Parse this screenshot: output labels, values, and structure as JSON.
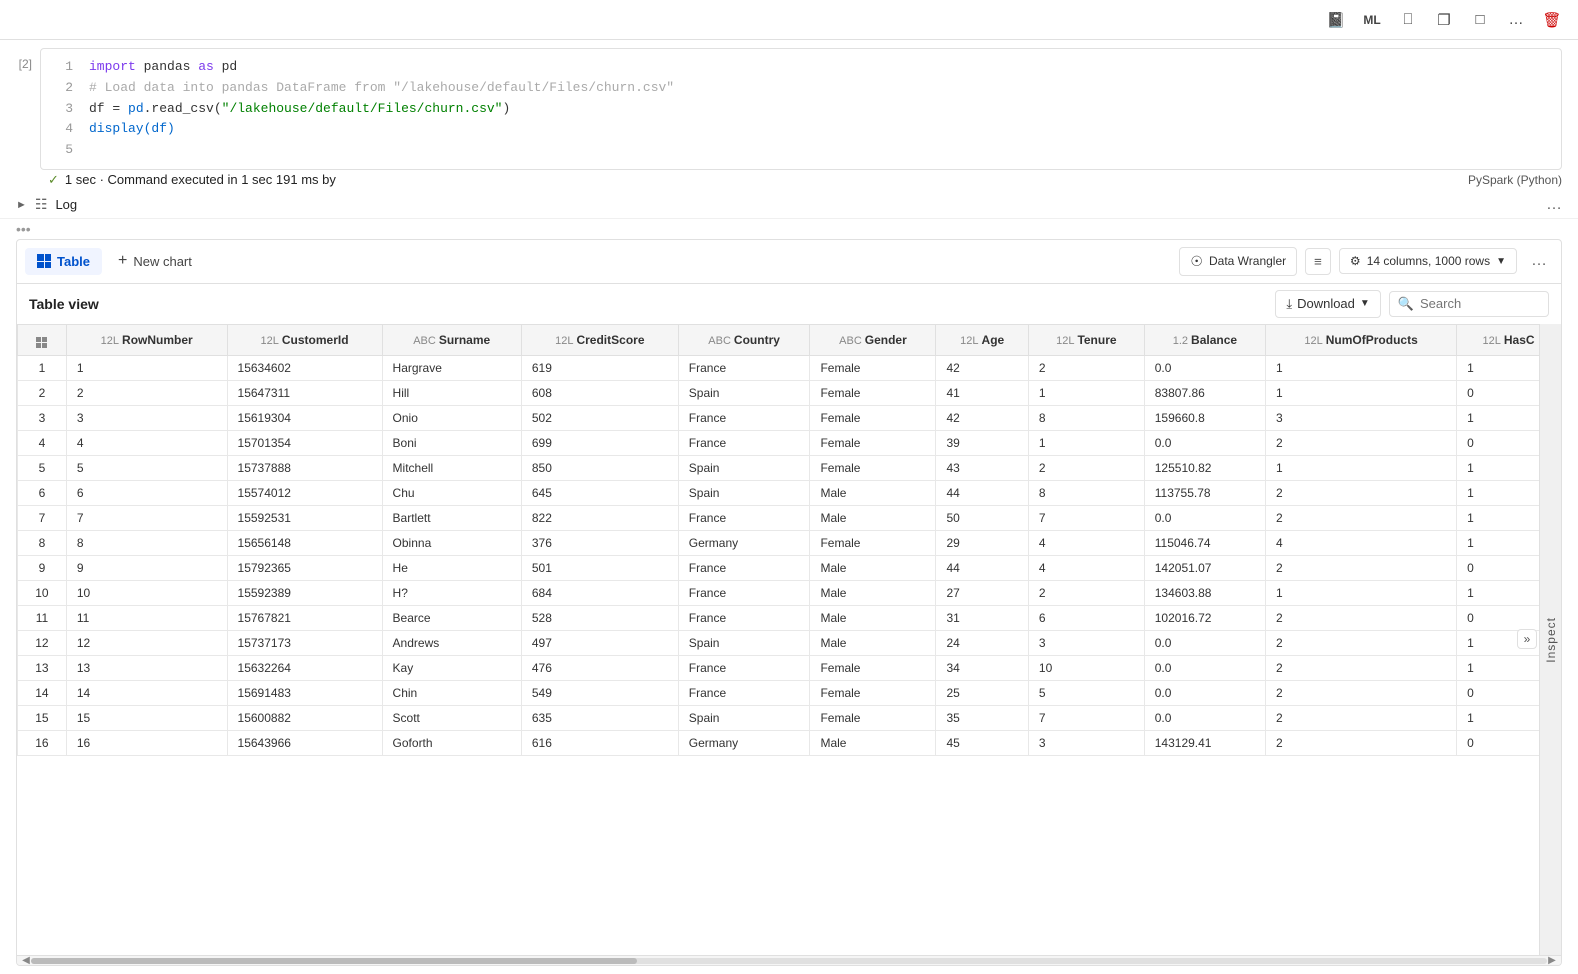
{
  "toolbar": {
    "icons": [
      "notebook-icon",
      "ml-icon",
      "monitor-icon",
      "copy-icon",
      "comment-icon",
      "more-icon",
      "delete-icon"
    ]
  },
  "cell": {
    "number": "[2]",
    "status": "1 sec · Command executed in 1 sec 191 ms by",
    "runtime": "PySpark (Python)",
    "lines": [
      {
        "num": "1",
        "tokens": [
          {
            "text": "import ",
            "cls": "kw"
          },
          {
            "text": "pandas",
            "cls": "plain"
          },
          {
            "text": " as ",
            "cls": "kw"
          },
          {
            "text": "pd",
            "cls": "plain"
          }
        ]
      },
      {
        "num": "2",
        "tokens": [
          {
            "text": "# Load data into pandas DataFrame from \"/lakehouse/default/Files/churn.csv\"",
            "cls": "cm"
          }
        ]
      },
      {
        "num": "3",
        "tokens": [
          {
            "text": "df",
            "cls": "plain"
          },
          {
            "text": " = ",
            "cls": "plain"
          },
          {
            "text": "pd",
            "cls": "fn"
          },
          {
            "text": ".read_csv(\"/lakehouse/default/Files/churn.csv\")",
            "cls": "st"
          }
        ]
      },
      {
        "num": "4",
        "tokens": [
          {
            "text": "display(df)",
            "cls": "fn"
          }
        ]
      },
      {
        "num": "5",
        "tokens": [
          {
            "text": "",
            "cls": "plain"
          }
        ]
      }
    ]
  },
  "log": {
    "label": "Log"
  },
  "output": {
    "tabs": [
      {
        "label": "Table",
        "icon": "grid-icon",
        "active": true
      },
      {
        "label": "New chart",
        "icon": "plus-icon",
        "active": false
      }
    ],
    "data_wrangler_label": "Data Wrangler",
    "col_info_label": "14 columns, 1000 rows",
    "table_view_title": "Table view",
    "download_label": "Download",
    "search_placeholder": "Search",
    "columns": [
      {
        "type": "12L",
        "name": "RowNumber"
      },
      {
        "type": "12L",
        "name": "CustomerId"
      },
      {
        "type": "ABC",
        "name": "Surname"
      },
      {
        "type": "12L",
        "name": "CreditScore"
      },
      {
        "type": "ABC",
        "name": "Country"
      },
      {
        "type": "ABC",
        "name": "Gender"
      },
      {
        "type": "12L",
        "name": "Age"
      },
      {
        "type": "12L",
        "name": "Tenure"
      },
      {
        "type": "1.2",
        "name": "Balance"
      },
      {
        "type": "12L",
        "name": "NumOfProducts"
      },
      {
        "type": "12L",
        "name": "HasC"
      }
    ],
    "rows": [
      [
        1,
        1,
        "15634602",
        "Hargrave",
        "619",
        "France",
        "Female",
        "42",
        "2",
        "0.0",
        "1",
        "1"
      ],
      [
        2,
        2,
        "15647311",
        "Hill",
        "608",
        "Spain",
        "Female",
        "41",
        "1",
        "83807.86",
        "1",
        "0"
      ],
      [
        3,
        3,
        "15619304",
        "Onio",
        "502",
        "France",
        "Female",
        "42",
        "8",
        "159660.8",
        "3",
        "1"
      ],
      [
        4,
        4,
        "15701354",
        "Boni",
        "699",
        "France",
        "Female",
        "39",
        "1",
        "0.0",
        "2",
        "0"
      ],
      [
        5,
        5,
        "15737888",
        "Mitchell",
        "850",
        "Spain",
        "Female",
        "43",
        "2",
        "125510.82",
        "1",
        "1"
      ],
      [
        6,
        6,
        "15574012",
        "Chu",
        "645",
        "Spain",
        "Male",
        "44",
        "8",
        "113755.78",
        "2",
        "1"
      ],
      [
        7,
        7,
        "15592531",
        "Bartlett",
        "822",
        "France",
        "Male",
        "50",
        "7",
        "0.0",
        "2",
        "1"
      ],
      [
        8,
        8,
        "15656148",
        "Obinna",
        "376",
        "Germany",
        "Female",
        "29",
        "4",
        "115046.74",
        "4",
        "1"
      ],
      [
        9,
        9,
        "15792365",
        "He",
        "501",
        "France",
        "Male",
        "44",
        "4",
        "142051.07",
        "2",
        "0"
      ],
      [
        10,
        10,
        "15592389",
        "H?",
        "684",
        "France",
        "Male",
        "27",
        "2",
        "134603.88",
        "1",
        "1"
      ],
      [
        11,
        11,
        "15767821",
        "Bearce",
        "528",
        "France",
        "Male",
        "31",
        "6",
        "102016.72",
        "2",
        "0"
      ],
      [
        12,
        12,
        "15737173",
        "Andrews",
        "497",
        "Spain",
        "Male",
        "24",
        "3",
        "0.0",
        "2",
        "1"
      ],
      [
        13,
        13,
        "15632264",
        "Kay",
        "476",
        "France",
        "Female",
        "34",
        "10",
        "0.0",
        "2",
        "1"
      ],
      [
        14,
        14,
        "15691483",
        "Chin",
        "549",
        "France",
        "Female",
        "25",
        "5",
        "0.0",
        "2",
        "0"
      ],
      [
        15,
        15,
        "15600882",
        "Scott",
        "635",
        "Spain",
        "Female",
        "35",
        "7",
        "0.0",
        "2",
        "1"
      ],
      [
        16,
        16,
        "15643966",
        "Goforth",
        "616",
        "Germany",
        "Male",
        "45",
        "3",
        "143129.41",
        "2",
        "0"
      ]
    ]
  }
}
